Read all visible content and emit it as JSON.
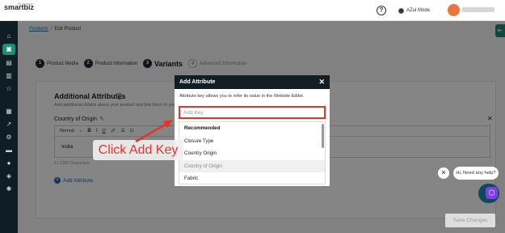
{
  "header": {
    "logo_text": "smartbiz",
    "logo_sub": "by amazon",
    "help_icon": "help-circle-icon",
    "mode_label": "AZui Mode"
  },
  "rail": {
    "icons": [
      "home-icon",
      "catalog-icon",
      "orders-icon",
      "analytics-icon",
      "star-icon",
      "store-icon",
      "marketing-icon",
      "settings-icon",
      "messages-icon",
      "payments-icon",
      "puzzle-icon",
      "gear-icon"
    ]
  },
  "breadcrumb": {
    "parent": "Products",
    "separator": "/",
    "current": "Edit Product"
  },
  "steps": [
    {
      "num": "1",
      "label": "Product Media"
    },
    {
      "num": "2",
      "label": "Product Information"
    },
    {
      "num": "3",
      "label": "Variants"
    },
    {
      "num": "4",
      "label": "Advanced Information"
    }
  ],
  "attributes": {
    "title": "Additional Attributes",
    "description": "Add additional details about your product and link them to your prod",
    "field_label": "Country of Origin",
    "toolbar": {
      "style": "Normal",
      "bold": "B",
      "italic": "I",
      "underline": "U",
      "link": "🔗",
      "ol": "☰",
      "ul": "☷"
    },
    "field_value": "India",
    "char_count": "5 / 1000 Characters",
    "add_label": "Add Attribute"
  },
  "save_label": "Save Changes",
  "modal": {
    "title": "Add Attribute",
    "close": "✕",
    "description": "Attribute key allows you to refer its value in the Website Editor.",
    "input_placeholder": "Add Key",
    "input_value": "",
    "group_label": "Recommended",
    "options": [
      "Closure Type",
      "Country Origin",
      "Country of Origin",
      "Fabric"
    ]
  },
  "annotation": {
    "text": "Click Add Key",
    "color": "#e8332a"
  },
  "chat": {
    "close": "✕",
    "greeting": "Hi, Need any help?"
  },
  "colors": {
    "accent": "#1b8d74",
    "rail": "#0f1d24",
    "link": "#1a6fb0",
    "highlight": "#e8332a"
  }
}
